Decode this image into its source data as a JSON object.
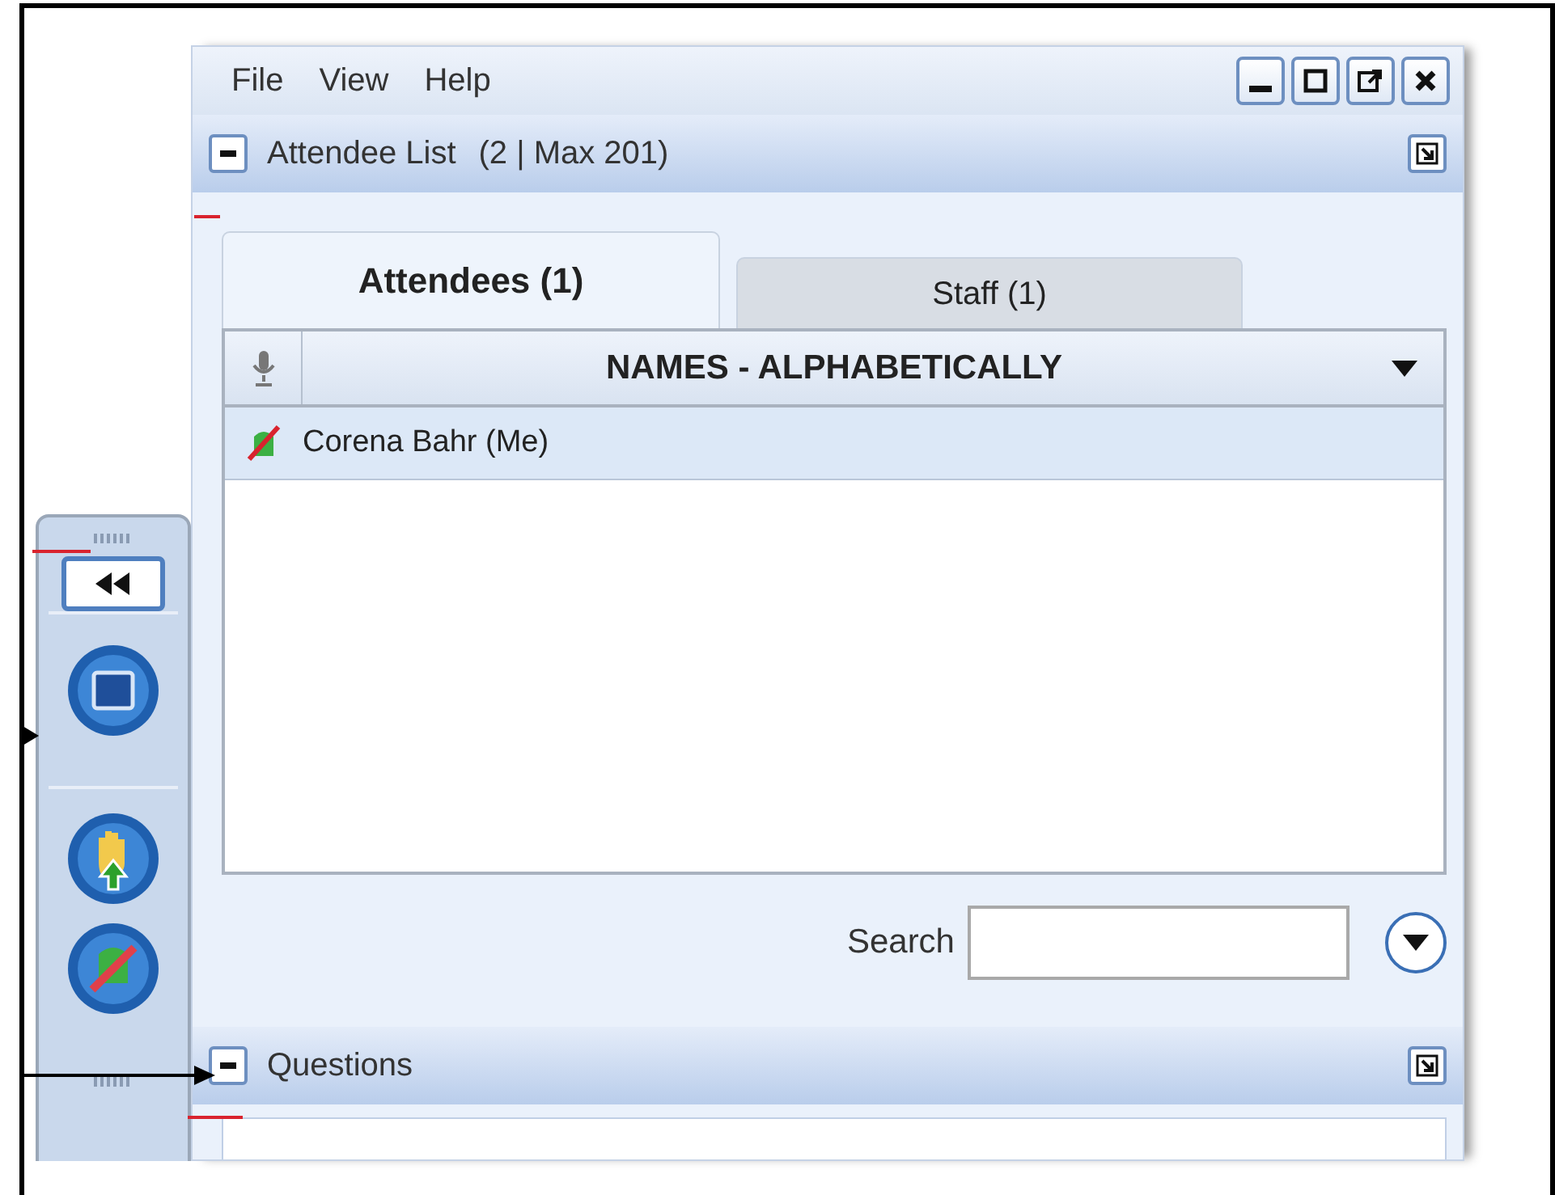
{
  "menu": [
    "File",
    "View",
    "Help"
  ],
  "attendee_panel": {
    "title": "Attendee List",
    "count": "(2 | Max 201)",
    "tabs": [
      {
        "label": "Attendees (1)",
        "selected": true
      },
      {
        "label": "Staff (1)",
        "selected": false
      }
    ],
    "columns": [
      "NAMES - ALPHABETICALLY"
    ],
    "rows": [
      {
        "name": "Corena Bahr (Me)",
        "selected": true
      }
    ],
    "search": {
      "label": "Search"
    }
  },
  "questions_panel": {
    "title": "Questions"
  }
}
